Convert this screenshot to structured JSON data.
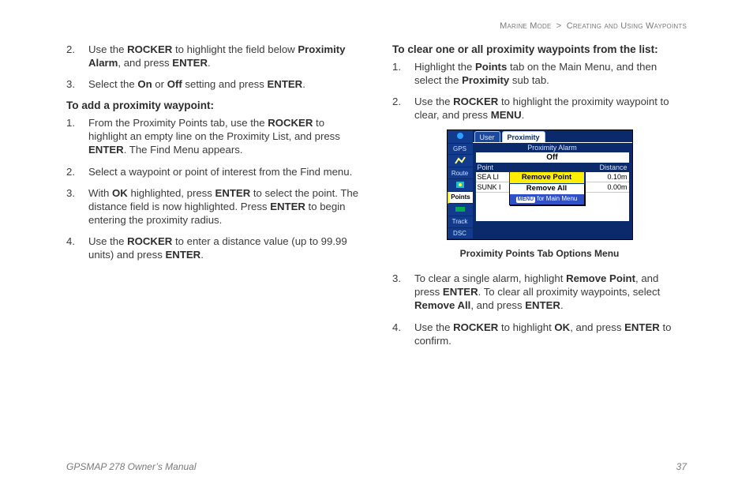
{
  "header": {
    "left": "Marine Mode",
    "sep": ">",
    "right": "Creating and Using Waypoints"
  },
  "left_col": {
    "pre_list": [
      {
        "n": "2.",
        "html": "Use the <b>ROCKER</b> to highlight the field below <b>Proximity Alarm</b>, and press <b>ENTER</b>."
      },
      {
        "n": "3.",
        "html": "Select the <b>On</b> or <b>Off</b> setting and press <b>ENTER</b>."
      }
    ],
    "h_add": "To add a proximity waypoint:",
    "add_list": [
      {
        "n": "1.",
        "html": "From the Proximity Points tab, use the <b>ROCKER</b> to highlight an empty line on the Proximity List, and press <b>ENTER</b>. The Find Menu appears."
      },
      {
        "n": "2.",
        "html": "Select a waypoint or point of interest from the Find menu."
      },
      {
        "n": "3.",
        "html": "With <b>OK</b> highlighted, press <b>ENTER</b> to select the point. The distance field is now highlighted. Press <b>ENTER</b> to begin entering the proximity radius."
      },
      {
        "n": "4.",
        "html": "Use the <b>ROCKER</b> to enter a distance value (up to 99.99 units) and press <b>ENTER</b>."
      }
    ]
  },
  "right_col": {
    "h_clear": "To clear one or all proximity waypoints from the list:",
    "clear_list_a": [
      {
        "n": "1.",
        "html": "Highlight the <b>Points</b> tab on the Main Menu, and then select the <b>Proximity</b> sub tab."
      },
      {
        "n": "2.",
        "html": "Use the <b>ROCKER</b> to highlight the proximity waypoint to clear, and press <b>MENU</b>."
      }
    ],
    "clear_list_b": [
      {
        "n": "3.",
        "html": "To clear a single alarm, highlight <b>Remove Point</b>, and press <b>ENTER</b>. To clear all proximity waypoints, select <b>Remove All</b>, and press <b>ENTER</b>."
      },
      {
        "n": "4.",
        "html": "Use the <b>ROCKER</b> to highlight <b>OK</b>, and press <b>ENTER</b> to confirm."
      }
    ]
  },
  "figure": {
    "caption": "Proximity Points Tab Options Menu",
    "left_tabs": [
      "GPS",
      "Route",
      "Points",
      "Track",
      "DSC"
    ],
    "left_selected": "Points",
    "top_tabs": [
      "User",
      "Proximity"
    ],
    "top_current": "Proximity",
    "row_label": "Proximity Alarm",
    "off_value": "Off",
    "cols": {
      "l": "Point",
      "r": "Distance"
    },
    "rows": [
      {
        "l": "SEA LI",
        "r": "0.10m"
      },
      {
        "l": "SUNK I",
        "r": "0.00m"
      }
    ],
    "menu": {
      "items": [
        "Remove Point",
        "Remove All"
      ],
      "selected": "Remove Point",
      "hint_btn": "MENU",
      "hint_text": "for Main Menu"
    }
  },
  "footer": {
    "left": "GPSMAP 278 Owner’s Manual",
    "right": "37"
  }
}
